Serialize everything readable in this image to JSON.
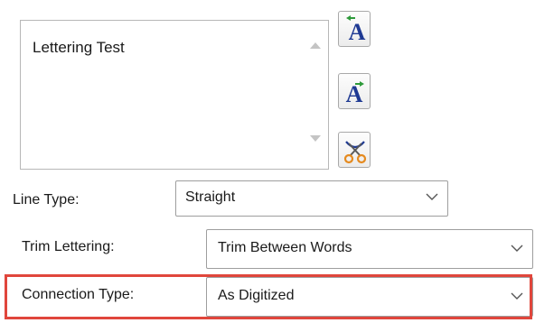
{
  "text_area": {
    "content": "Lettering Test"
  },
  "tool_buttons": [
    {
      "icon": "lettering-insert-before-icon"
    },
    {
      "icon": "lettering-insert-after-icon"
    },
    {
      "icon": "scissors-trim-icon"
    }
  ],
  "line_type": {
    "label": "Line Type:",
    "value": "Straight"
  },
  "trim_lettering": {
    "label": "Trim Lettering:",
    "value": "Trim Between Words"
  },
  "connection_type": {
    "label": "Connection Type:",
    "value": "As Digitized"
  },
  "colors": {
    "highlight": "#e0463c",
    "letter_blue": "#1f3a93",
    "arrow_green": "#2e9a3a",
    "scissors_orange": "#e58a1f"
  }
}
